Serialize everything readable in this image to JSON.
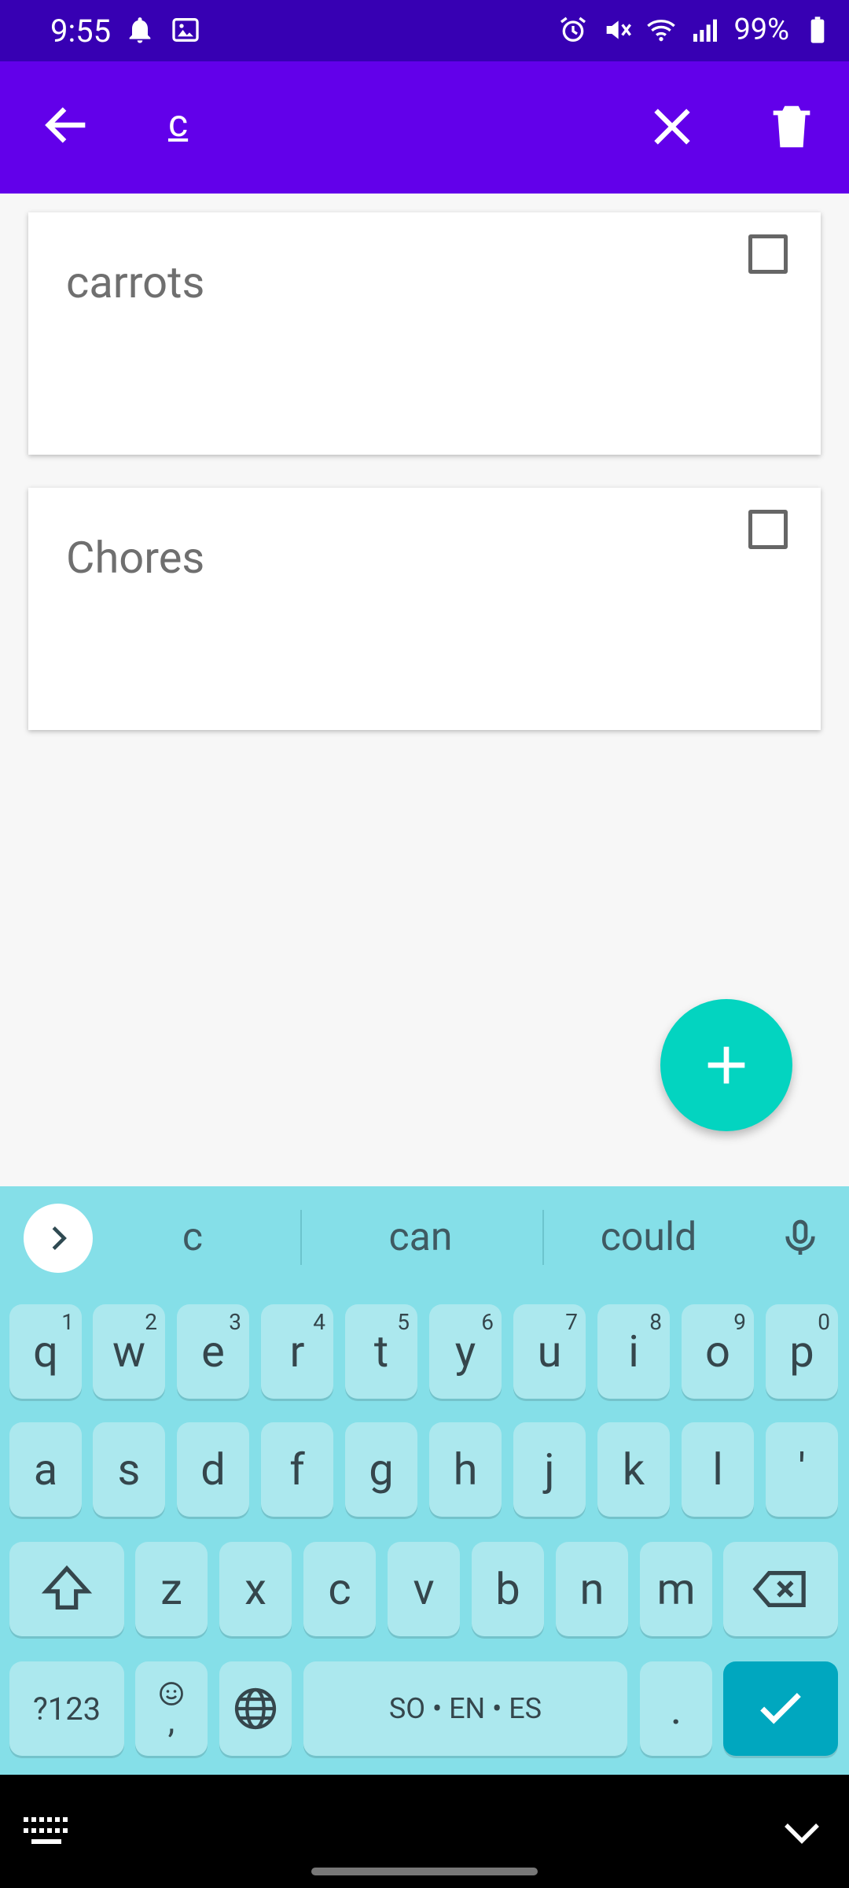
{
  "status_bar": {
    "time": "9:55",
    "battery": "99%"
  },
  "app_bar": {
    "query_text": "c"
  },
  "cards": [
    {
      "title": "carrots"
    },
    {
      "title": "Chores"
    }
  ],
  "keyboard": {
    "suggestions": [
      "c",
      "can",
      "could"
    ],
    "row1": [
      {
        "label": "q",
        "sup": "1"
      },
      {
        "label": "w",
        "sup": "2"
      },
      {
        "label": "e",
        "sup": "3"
      },
      {
        "label": "r",
        "sup": "4"
      },
      {
        "label": "t",
        "sup": "5"
      },
      {
        "label": "y",
        "sup": "6"
      },
      {
        "label": "u",
        "sup": "7"
      },
      {
        "label": "i",
        "sup": "8"
      },
      {
        "label": "o",
        "sup": "9"
      },
      {
        "label": "p",
        "sup": "0"
      }
    ],
    "row2": [
      "a",
      "s",
      "d",
      "f",
      "g",
      "h",
      "j",
      "k",
      "l",
      "'"
    ],
    "row3": [
      "z",
      "x",
      "c",
      "v",
      "b",
      "n",
      "m"
    ],
    "row4": {
      "symbols": "?123",
      "emoji_comma": ",",
      "space": "SO • EN • ES",
      "period": "."
    }
  }
}
